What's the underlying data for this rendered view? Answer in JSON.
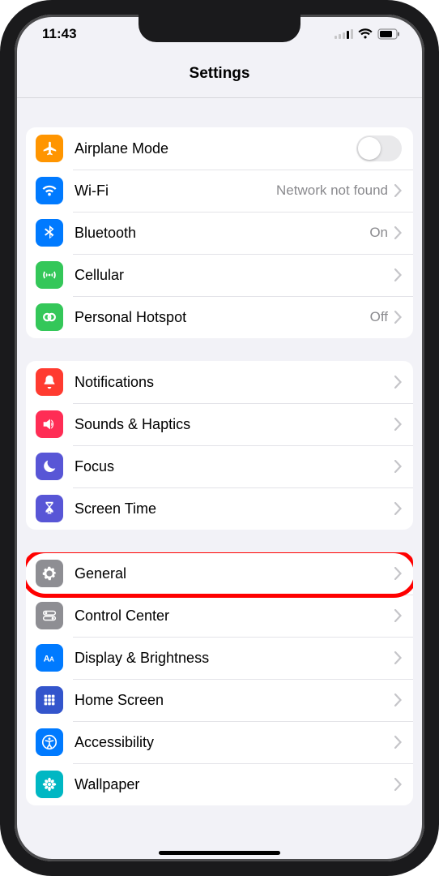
{
  "status": {
    "time": "11:43"
  },
  "header": {
    "title": "Settings"
  },
  "groups": [
    {
      "rows": [
        {
          "id": "airplane-mode",
          "label": "Airplane Mode",
          "type": "toggle",
          "toggled": false,
          "icon": "airplane",
          "color": "#ff9500"
        },
        {
          "id": "wifi",
          "label": "Wi-Fi",
          "type": "link",
          "detail": "Network not found",
          "icon": "wifi",
          "color": "#007aff"
        },
        {
          "id": "bluetooth",
          "label": "Bluetooth",
          "type": "link",
          "detail": "On",
          "icon": "bluetooth",
          "color": "#007aff"
        },
        {
          "id": "cellular",
          "label": "Cellular",
          "type": "link",
          "detail": "",
          "icon": "cellular",
          "color": "#34c759"
        },
        {
          "id": "personal-hotspot",
          "label": "Personal Hotspot",
          "type": "link",
          "detail": "Off",
          "icon": "hotspot",
          "color": "#34c759"
        }
      ]
    },
    {
      "rows": [
        {
          "id": "notifications",
          "label": "Notifications",
          "type": "link",
          "detail": "",
          "icon": "bell",
          "color": "#ff3b30"
        },
        {
          "id": "sounds-haptics",
          "label": "Sounds & Haptics",
          "type": "link",
          "detail": "",
          "icon": "speaker",
          "color": "#ff2d55"
        },
        {
          "id": "focus",
          "label": "Focus",
          "type": "link",
          "detail": "",
          "icon": "moon",
          "color": "#5856d6"
        },
        {
          "id": "screen-time",
          "label": "Screen Time",
          "type": "link",
          "detail": "",
          "icon": "hourglass",
          "color": "#5856d6"
        }
      ]
    },
    {
      "rows": [
        {
          "id": "general",
          "label": "General",
          "type": "link",
          "detail": "",
          "icon": "gear",
          "color": "#8e8e93",
          "highlighted": true
        },
        {
          "id": "control-center",
          "label": "Control Center",
          "type": "link",
          "detail": "",
          "icon": "switches",
          "color": "#8e8e93"
        },
        {
          "id": "display-brightness",
          "label": "Display & Brightness",
          "type": "link",
          "detail": "",
          "icon": "aa",
          "color": "#007aff"
        },
        {
          "id": "home-screen",
          "label": "Home Screen",
          "type": "link",
          "detail": "",
          "icon": "grid",
          "color": "#3355cc"
        },
        {
          "id": "accessibility",
          "label": "Accessibility",
          "type": "link",
          "detail": "",
          "icon": "accessibility",
          "color": "#007aff"
        },
        {
          "id": "wallpaper",
          "label": "Wallpaper",
          "type": "link",
          "detail": "",
          "icon": "flower",
          "color": "#00b7c3"
        }
      ]
    }
  ]
}
